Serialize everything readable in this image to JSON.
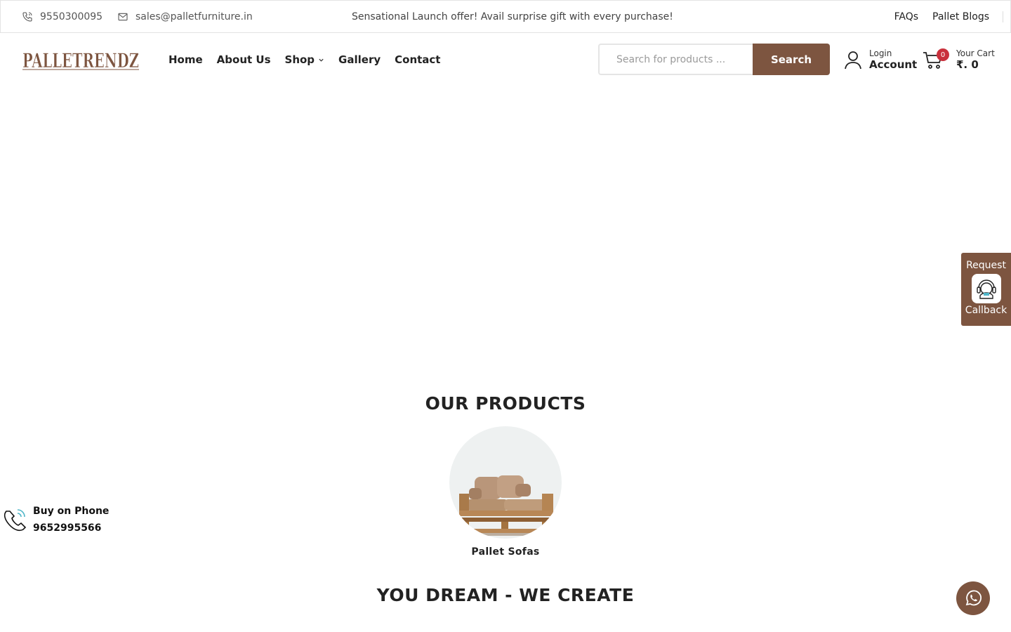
{
  "topbar": {
    "phone": "9550300095",
    "email": "sales@palletfurniture.in",
    "promo": "Sensational Launch offer! Avail surprise gift with every purchase!",
    "links": [
      "FAQs",
      "Pallet Blogs"
    ]
  },
  "header": {
    "logo_text": "PALLETRENDZ",
    "nav": [
      "Home",
      "About Us",
      "Shop",
      "Gallery",
      "Contact"
    ],
    "search": {
      "placeholder": "Search for products ...",
      "button": "Search"
    },
    "account": {
      "small": "Login",
      "big": "Account"
    },
    "cart": {
      "count": "0",
      "small": "Your Cart",
      "big": "₹. 0"
    }
  },
  "products": {
    "title": "OUR PRODUCTS",
    "items": [
      {
        "name": "Pallet Sofas"
      }
    ]
  },
  "dream_title": "YOU DREAM - WE CREATE",
  "callback": {
    "line1": "Request",
    "line2": "Callback"
  },
  "buy_phone": {
    "label": "Buy on Phone",
    "number": "9652995566"
  },
  "colors": {
    "brand": "#7d5540",
    "badge": "#c9313c"
  },
  "icons": [
    "phone-icon",
    "mail-icon",
    "chevron-down-icon",
    "user-icon",
    "cart-icon",
    "support-agent-icon",
    "phone-call-icon",
    "whatsapp-icon"
  ]
}
